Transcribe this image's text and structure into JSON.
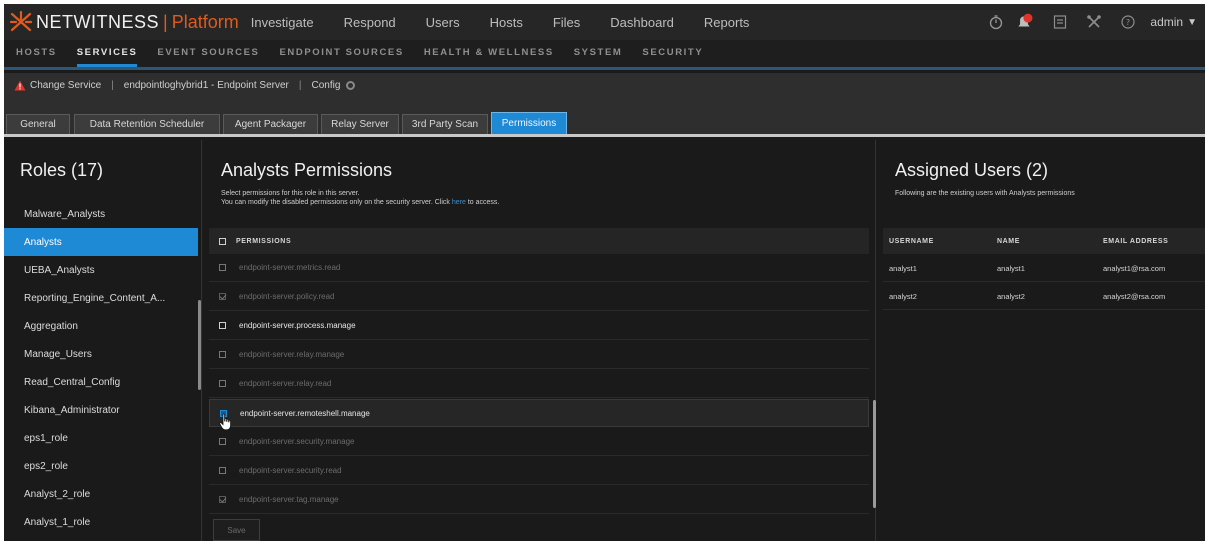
{
  "header": {
    "brand": "NETWITNESS",
    "brand_sep": "|",
    "brand_product": "Platform",
    "nav": [
      "Investigate",
      "Respond",
      "Users",
      "Hosts",
      "Files",
      "Dashboard",
      "Reports"
    ],
    "user": "admin",
    "icons": [
      "timer-icon",
      "notification-icon",
      "tasks-icon",
      "tools-icon",
      "help-icon"
    ]
  },
  "subnav": {
    "items": [
      "HOSTS",
      "SERVICES",
      "EVENT SOURCES",
      "ENDPOINT SOURCES",
      "HEALTH & WELLNESS",
      "SYSTEM",
      "SECURITY"
    ],
    "active": "SERVICES"
  },
  "service_bar": {
    "change_service": "Change Service",
    "sep1": "|",
    "service_name": "endpointloghybrid1 - Endpoint Server",
    "sep2": "|",
    "config": "Config"
  },
  "tabs": {
    "items": [
      "General",
      "Data Retention Scheduler",
      "Agent Packager",
      "Relay Server",
      "3rd Party Scan",
      "Permissions"
    ],
    "active": "Permissions"
  },
  "roles": {
    "title": "Roles (17)",
    "items": [
      "Malware_Analysts",
      "Analysts",
      "UEBA_Analysts",
      "Reporting_Engine_Content_A...",
      "Aggregation",
      "Manage_Users",
      "Read_Central_Config",
      "Kibana_Administrator",
      "eps1_role",
      "eps2_role",
      "Analyst_2_role",
      "Analyst_1_role"
    ],
    "active": "Analysts"
  },
  "permissions": {
    "title": "Analysts Permissions",
    "desc_line1": "Select permissions for this role in this server.",
    "desc_line2_prefix": "You can modify the disabled permissions only on the security server. Click",
    "desc_link": "here",
    "desc_line2_suffix": "to access.",
    "column_header": "PERMISSIONS",
    "rows": [
      {
        "label": "endpoint-server.metrics.read",
        "enabled": false,
        "checked": false
      },
      {
        "label": "endpoint-server.policy.read",
        "enabled": false,
        "checked": true
      },
      {
        "label": "endpoint-server.process.manage",
        "enabled": true,
        "checked": false
      },
      {
        "label": "endpoint-server.relay.manage",
        "enabled": false,
        "checked": false
      },
      {
        "label": "endpoint-server.relay.read",
        "enabled": false,
        "checked": false
      },
      {
        "label": "endpoint-server.remoteshell.manage",
        "enabled": true,
        "checked": false
      },
      {
        "label": "endpoint-server.security.manage",
        "enabled": false,
        "checked": false
      },
      {
        "label": "endpoint-server.security.read",
        "enabled": false,
        "checked": false
      },
      {
        "label": "endpoint-server.tag.manage",
        "enabled": false,
        "checked": true
      }
    ],
    "save_label": "Save"
  },
  "assigned_users": {
    "title": "Assigned Users (2)",
    "desc": "Following are the existing users with Analysts permissions",
    "columns": [
      "USERNAME",
      "NAME",
      "EMAIL ADDRESS"
    ],
    "rows": [
      [
        "analyst1",
        "analyst1",
        "analyst1@rsa.com"
      ],
      [
        "analyst2",
        "analyst2",
        "analyst2@rsa.com"
      ]
    ]
  },
  "colors": {
    "accent": "#1e8ad6",
    "brand_orange": "#e05a1c",
    "warning": "#e0342a",
    "background": "#1a1a1a"
  }
}
